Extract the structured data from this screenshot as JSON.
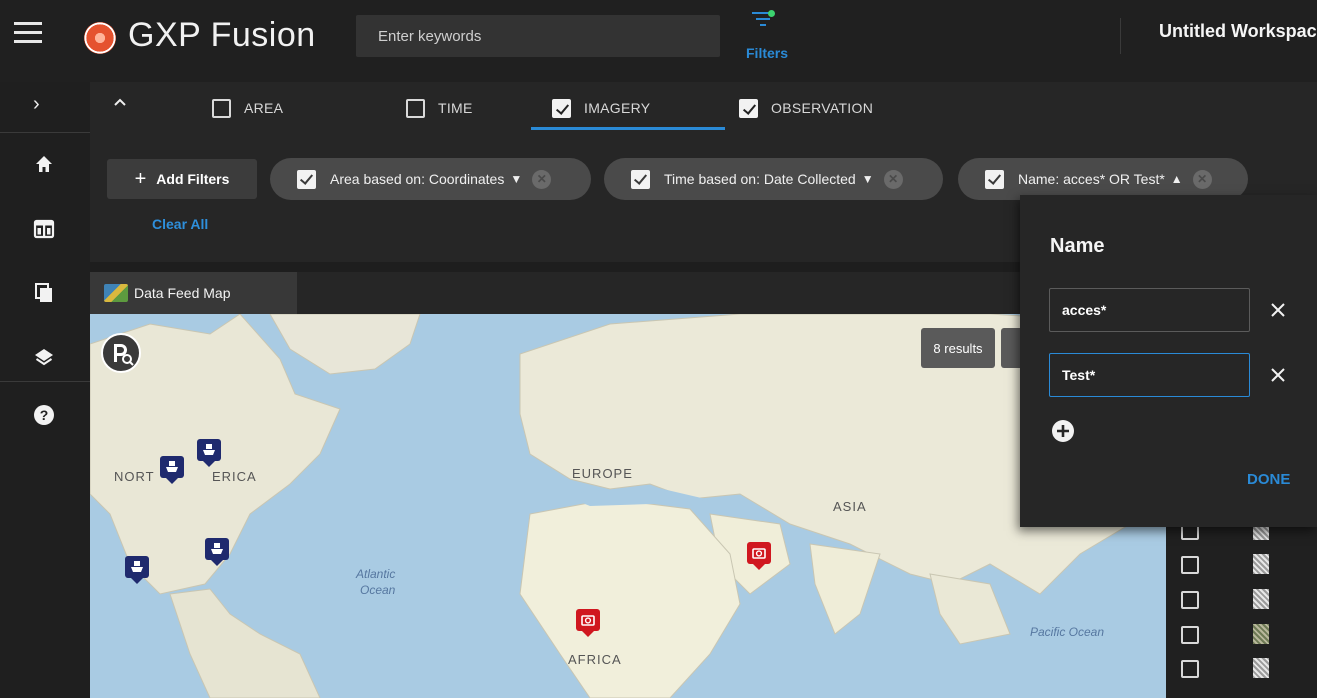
{
  "header": {
    "brand": "GXP Fusion",
    "search_placeholder": "Enter keywords",
    "filters_label": "Filters",
    "workspace_title": "Untitled Workspace"
  },
  "filter_tabs": [
    {
      "label": "AREA",
      "checked": false
    },
    {
      "label": "TIME",
      "checked": false
    },
    {
      "label": "IMAGERY",
      "checked": true,
      "active": true
    },
    {
      "label": "OBSERVATION",
      "checked": true
    }
  ],
  "filter_bar": {
    "add_filters_label": "Add Filters",
    "clear_all_label": "Clear All",
    "chips": [
      {
        "label": "Area based on: Coordinates",
        "checked": true,
        "expanded": false
      },
      {
        "label": "Time based on: Date Collected",
        "checked": true,
        "expanded": false
      },
      {
        "label": "Name: acces* OR Test*",
        "checked": true,
        "expanded": true
      }
    ]
  },
  "map_panel": {
    "tab_label": "Data Feed Map",
    "results_count_label": "8 results",
    "labels": {
      "north_america_left": "NORT",
      "north_america_right": "ERICA",
      "europe": "EUROPE",
      "asia": "ASIA",
      "africa": "AFRICA",
      "atlantic_1": "Atlantic",
      "atlantic_2": "Ocean",
      "pacific": "Pacific Ocean"
    },
    "markers": [
      {
        "type": "ship",
        "icon": "ship-icon"
      },
      {
        "type": "ship",
        "icon": "ship-icon"
      },
      {
        "type": "ship",
        "icon": "ship-icon"
      },
      {
        "type": "ship",
        "icon": "ship-icon"
      },
      {
        "type": "imagery",
        "icon": "camera-icon"
      },
      {
        "type": "imagery",
        "icon": "camera-icon"
      }
    ]
  },
  "name_popover": {
    "title": "Name",
    "inputs": [
      {
        "value": "acces*"
      },
      {
        "value": "Test*"
      }
    ],
    "done_label": "DONE"
  },
  "colors": {
    "accent": "#2a8ad6",
    "ship_marker": "#1f2a6e",
    "camera_marker": "#d0171f",
    "header_bg": "#202020"
  }
}
